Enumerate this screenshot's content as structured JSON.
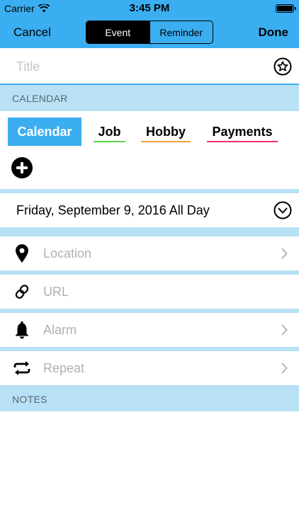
{
  "status_bar": {
    "carrier": "Carrier",
    "time": "3:45 PM",
    "battery_level": 1.0
  },
  "nav": {
    "cancel_label": "Cancel",
    "done_label": "Done",
    "segments": [
      "Event",
      "Reminder"
    ],
    "selected_segment": "Event"
  },
  "title_field": {
    "placeholder": "Title",
    "value": "",
    "icon": "star-circle-icon"
  },
  "calendar_section": {
    "header": "CALENDAR",
    "calendars": [
      {
        "label": "Calendar",
        "selected": true,
        "color": "#3aaef0"
      },
      {
        "label": "Job",
        "selected": false,
        "color": "#5cd64a"
      },
      {
        "label": "Hobby",
        "selected": false,
        "color": "#f3a13b"
      },
      {
        "label": "Payments",
        "selected": false,
        "color": "#ec2f74"
      }
    ],
    "add_icon": "plus-circle-icon"
  },
  "date_row": {
    "text": "Friday, September 9, 2016 All Day",
    "icon": "chevron-down-circle-icon"
  },
  "rows": [
    {
      "placeholder": "Location",
      "icon": "location-pin-icon",
      "has_arrow": true
    },
    {
      "placeholder": "URL",
      "icon": "link-icon",
      "has_arrow": false
    },
    {
      "placeholder": "Alarm",
      "icon": "bell-icon",
      "has_arrow": true
    },
    {
      "placeholder": "Repeat",
      "icon": "repeat-icon",
      "has_arrow": true
    }
  ],
  "notes_section": {
    "header": "NOTES"
  },
  "colors": {
    "accent": "#3aaef0",
    "section_bg": "#b8e1f6",
    "placeholder": "#b0b0b0"
  }
}
